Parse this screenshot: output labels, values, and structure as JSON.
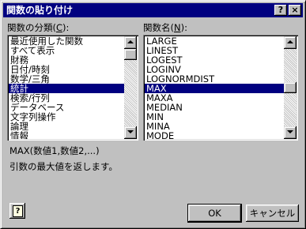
{
  "window": {
    "title": "関数の貼り付け",
    "help_button": "?",
    "close_button": "×"
  },
  "category": {
    "label_text": "関数の分類(",
    "label_key": "C",
    "label_end": "):",
    "items": [
      "最近使用した関数",
      "すべて表示",
      "財務",
      "日付/時刻",
      "数学/三角",
      "統計",
      "検索/行列",
      "データベース",
      "文字列操作",
      "論理",
      "情報"
    ],
    "selected": "統計"
  },
  "function_name": {
    "label_text": "関数名(",
    "label_key": "N",
    "label_end": "):",
    "items": [
      "LARGE",
      "LINEST",
      "LOGEST",
      "LOGINV",
      "LOGNORMDIST",
      "MAX",
      "MAXA",
      "MEDIAN",
      "MIN",
      "MINA",
      "MODE"
    ],
    "selected": "MAX"
  },
  "syntax": "MAX(数値1,数値2,...)",
  "description": "引数の最大値を返します。",
  "buttons": {
    "ok": "OK",
    "cancel": "キャンセル"
  }
}
